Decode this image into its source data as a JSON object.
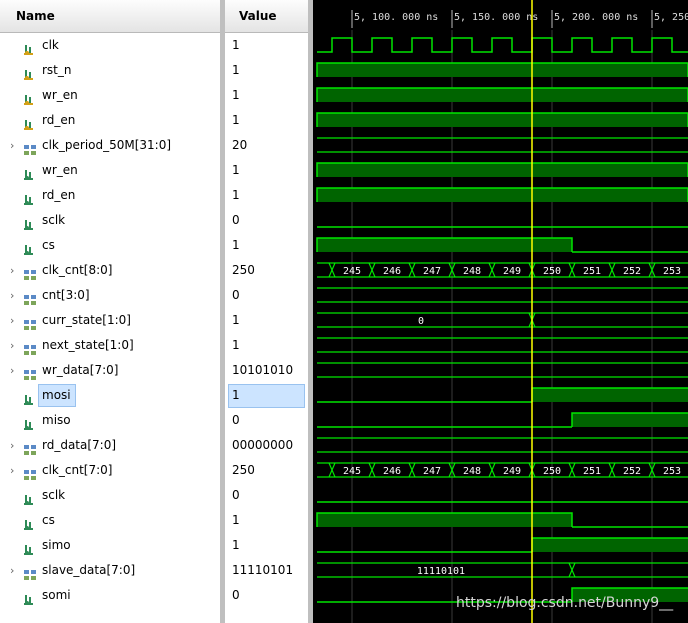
{
  "headers": {
    "name": "Name",
    "value": "Value"
  },
  "signals": [
    {
      "name": "clk",
      "value": "1",
      "type": "bit",
      "port": "top",
      "expand": false
    },
    {
      "name": "rst_n",
      "value": "1",
      "type": "bit",
      "port": "top",
      "expand": false
    },
    {
      "name": "wr_en",
      "value": "1",
      "type": "bit",
      "port": "top",
      "expand": false
    },
    {
      "name": "rd_en",
      "value": "1",
      "type": "bit",
      "port": "top",
      "expand": false
    },
    {
      "name": "clk_period_50M[31:0]",
      "value": "20",
      "type": "bus",
      "port": "top",
      "expand": true
    },
    {
      "name": "wr_en",
      "value": "1",
      "type": "bit",
      "port": "sub",
      "expand": false
    },
    {
      "name": "rd_en",
      "value": "1",
      "type": "bit",
      "port": "sub",
      "expand": false
    },
    {
      "name": "sclk",
      "value": "0",
      "type": "bit",
      "port": "sub",
      "expand": false
    },
    {
      "name": "cs",
      "value": "1",
      "type": "bit",
      "port": "sub",
      "expand": false
    },
    {
      "name": "clk_cnt[8:0]",
      "value": "250",
      "type": "bus",
      "port": "sub",
      "expand": true
    },
    {
      "name": "cnt[3:0]",
      "value": "0",
      "type": "bus",
      "port": "sub",
      "expand": true
    },
    {
      "name": "curr_state[1:0]",
      "value": "1",
      "type": "bus",
      "port": "sub",
      "expand": true
    },
    {
      "name": "next_state[1:0]",
      "value": "1",
      "type": "bus",
      "port": "sub",
      "expand": true
    },
    {
      "name": "wr_data[7:0]",
      "value": "10101010",
      "type": "bus",
      "port": "sub",
      "expand": true
    },
    {
      "name": "mosi",
      "value": "1",
      "type": "bit",
      "port": "sub",
      "expand": false,
      "selected": true
    },
    {
      "name": "miso",
      "value": "0",
      "type": "bit",
      "port": "sub",
      "expand": false
    },
    {
      "name": "rd_data[7:0]",
      "value": "00000000",
      "type": "bus",
      "port": "sub",
      "expand": true
    },
    {
      "name": "clk_cnt[7:0]",
      "value": "250",
      "type": "bus",
      "port": "sub",
      "expand": true
    },
    {
      "name": "sclk",
      "value": "0",
      "type": "bit",
      "port": "sub",
      "expand": false
    },
    {
      "name": "cs",
      "value": "1",
      "type": "bit",
      "port": "sub",
      "expand": false
    },
    {
      "name": "simo",
      "value": "1",
      "type": "bit",
      "port": "sub",
      "expand": false
    },
    {
      "name": "slave_data[7:0]",
      "value": "11110101",
      "type": "bus",
      "port": "sub",
      "expand": true
    },
    {
      "name": "somi",
      "value": "0",
      "type": "bit",
      "port": "sub",
      "expand": false
    }
  ],
  "timeline": {
    "labels": [
      "5, 100. 000  ns",
      "5, 150. 000  ns",
      "5, 200. 000  ns",
      "5, 250."
    ]
  },
  "bus_labels": {
    "clk_cnt": [
      "245",
      "246",
      "247",
      "248",
      "249",
      "250",
      "251",
      "252",
      "253"
    ],
    "curr_state_before": "0",
    "slave_data_before": "11110101"
  },
  "watermark": "https://blog.csdn.net/Bunny9__",
  "colors": {
    "wave_line": "#00e600",
    "wave_fill": "#006400",
    "cursor": "#ffff00",
    "selection": "#cce4ff"
  }
}
